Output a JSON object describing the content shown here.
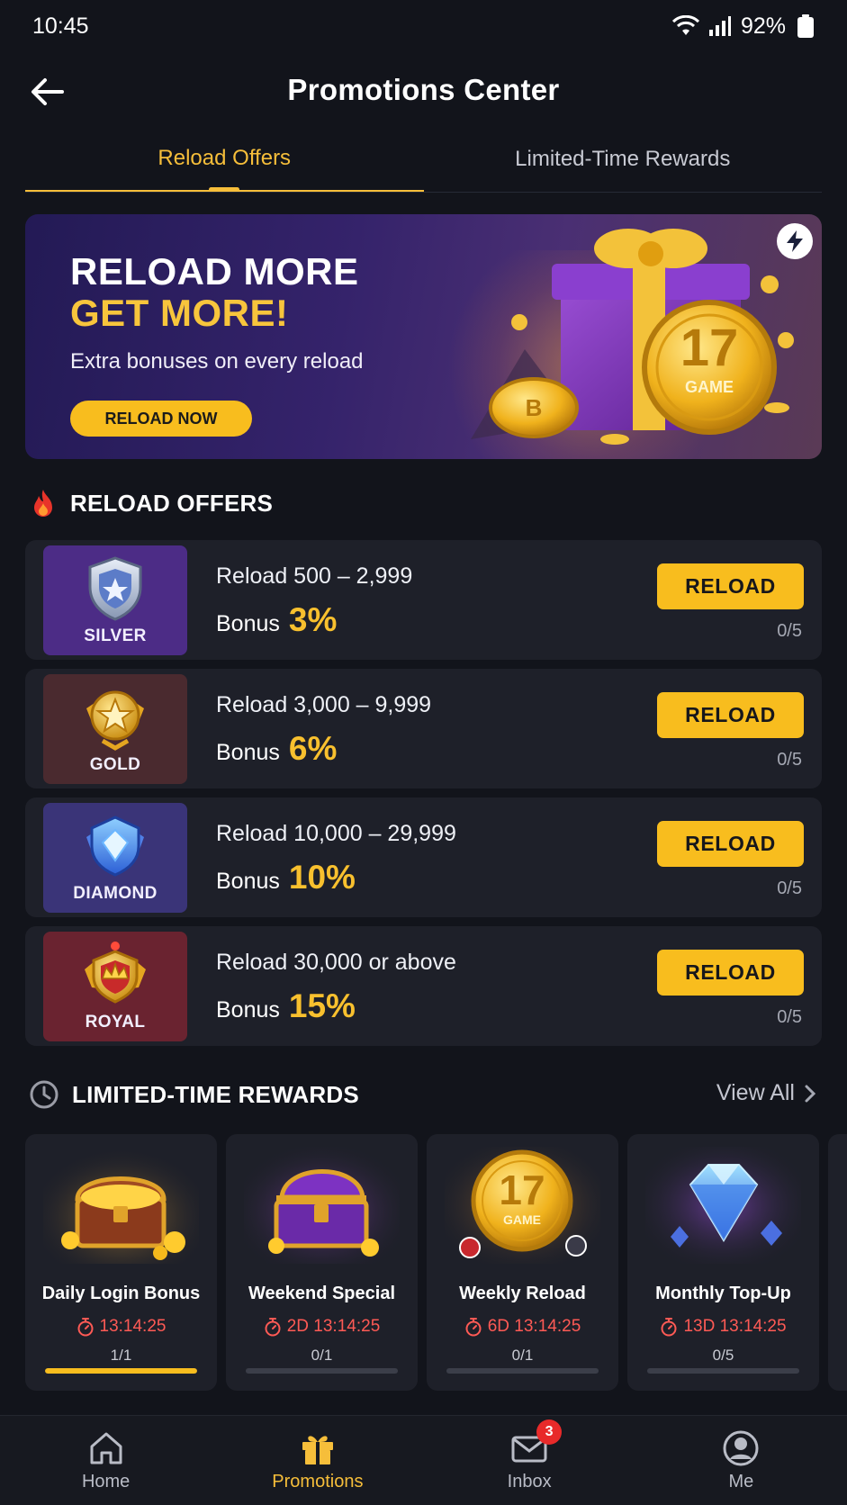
{
  "status_bar": {
    "time": "10:45",
    "battery": "92%"
  },
  "header": {
    "title": "Promotions Center"
  },
  "tabs": [
    {
      "label": "Reload Offers",
      "active": true
    },
    {
      "label": "Limited-Time Rewards",
      "active": false
    }
  ],
  "banner": {
    "line1": "RELOAD MORE",
    "line2": "GET MORE!",
    "subtitle": "Extra bonuses on every reload",
    "cta": "RELOAD NOW",
    "coin_text_top": "17",
    "coin_text_bottom": "GAME",
    "small_coin_text": "B"
  },
  "reload_section": {
    "title": "RELOAD OFFERS",
    "offers": [
      {
        "tier": "SILVER",
        "range": "Reload 500 – 2,999",
        "bonus_label": "Bonus",
        "bonus": "3%",
        "button": "RELOAD",
        "progress": "0/5",
        "tier_color": "#4c2c86"
      },
      {
        "tier": "GOLD",
        "range": "Reload 3,000 – 9,999",
        "bonus_label": "Bonus",
        "bonus": "6%",
        "button": "RELOAD",
        "progress": "0/5",
        "tier_color": "#4a2a2f"
      },
      {
        "tier": "DIAMOND",
        "range": "Reload 10,000 – 29,999",
        "bonus_label": "Bonus",
        "bonus": "10%",
        "button": "RELOAD",
        "progress": "0/5",
        "tier_color": "#3a3478"
      },
      {
        "tier": "ROYAL",
        "range": "Reload 30,000 or above",
        "bonus_label": "Bonus",
        "bonus": "15%",
        "button": "RELOAD",
        "progress": "0/5",
        "tier_color": "#6a2330"
      }
    ]
  },
  "rewards_section": {
    "title": "LIMITED-TIME REWARDS",
    "view_all": "View All",
    "items": [
      {
        "title": "Daily Login Bonus",
        "timer": "13:14:25",
        "progress": "1/1",
        "fill": 1.0,
        "art": "treasure-chest-gold"
      },
      {
        "title": "Weekend Special",
        "timer": "2D 13:14:25",
        "progress": "0/1",
        "fill": 0,
        "art": "treasure-chest-purple"
      },
      {
        "title": "Weekly Reload",
        "timer": "6D 13:14:25",
        "progress": "0/1",
        "fill": 0,
        "art": "game-coin",
        "coin_text_top": "17",
        "coin_text_bottom": "GAME"
      },
      {
        "title": "Monthly Top-Up",
        "timer": "13D 13:14:25",
        "progress": "0/5",
        "fill": 0,
        "art": "diamond"
      }
    ]
  },
  "bottom_nav": [
    {
      "label": "Home",
      "icon": "home-icon",
      "active": false
    },
    {
      "label": "Promotions",
      "icon": "gift-icon",
      "active": true
    },
    {
      "label": "Inbox",
      "icon": "mail-icon",
      "active": false,
      "badge": "3"
    },
    {
      "label": "Me",
      "icon": "user-icon",
      "active": false
    }
  ],
  "colors": {
    "accent": "#f8bd1e",
    "timer": "#ff5a55",
    "background": "#12141b",
    "card": "#1e2029"
  }
}
